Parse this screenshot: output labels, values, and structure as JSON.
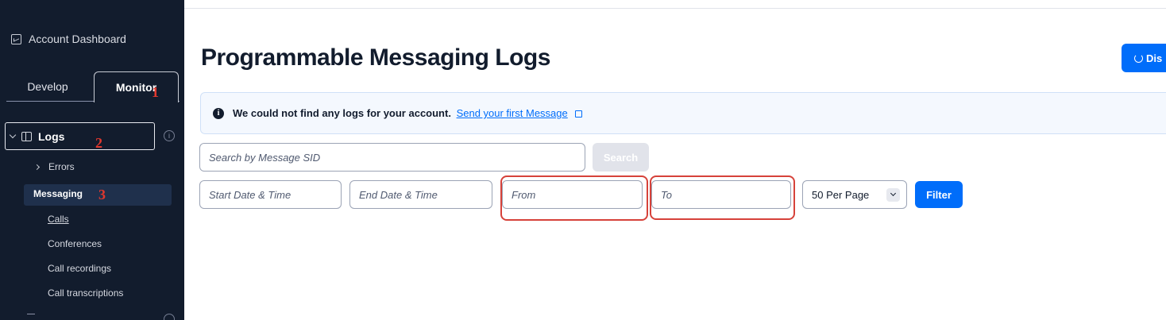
{
  "sidebar": {
    "account_dashboard": "Account Dashboard",
    "tabs": {
      "develop": "Develop",
      "monitor": "Monitor"
    },
    "logs_label": "Logs",
    "info_glyph": "i",
    "items": {
      "errors": "Errors",
      "messaging": "Messaging",
      "calls": "Calls",
      "conferences": "Conferences",
      "call_recordings": "Call recordings",
      "call_transcriptions": "Call transcriptions"
    }
  },
  "annotations": {
    "marker1": "1",
    "marker2": "2",
    "marker3": "3"
  },
  "main": {
    "title": "Programmable Messaging Logs",
    "top_button": "Dis",
    "alert": {
      "icon": "i",
      "text": "We could not find any logs for your account.",
      "link": "Send your first Message"
    },
    "search": {
      "placeholder": "Search by Message SID",
      "button": "Search"
    },
    "filters": {
      "start": "Start Date & Time",
      "end": "End Date & Time",
      "from": "From",
      "to": "To",
      "per_page": "50 Per Page",
      "filter_button": "Filter"
    }
  },
  "colors": {
    "sidebar_bg": "#121c2d",
    "primary": "#006dfa",
    "highlight": "#d6423a"
  }
}
